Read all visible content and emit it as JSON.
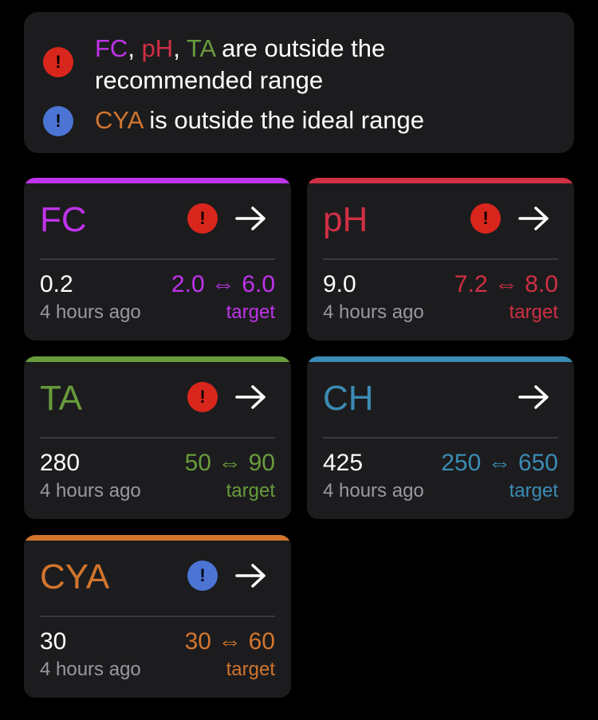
{
  "colors": {
    "fc": "#bf33ea",
    "ph": "#d02f44",
    "ta": "#689b3c",
    "ch": "#3b8cb5",
    "cya": "#d2752e",
    "warn_red": "#d9261c",
    "warn_blue": "#4b74d4",
    "card_bg": "#1c1c1e",
    "muted_text": "#98989e"
  },
  "alerts": {
    "recommended": {
      "icon": "exclamation-icon",
      "fc": "FC",
      "sep1": ", ",
      "ph": "pH",
      "sep2": ", ",
      "ta": "TA",
      "text_line1": " are outside the",
      "text_line2": "recommended range"
    },
    "ideal": {
      "icon": "exclamation-icon",
      "cya": "CYA",
      "text": " is outside the ideal range"
    }
  },
  "cards": {
    "fc": {
      "title": "FC",
      "value": "0.2",
      "time": "4 hours ago",
      "range": "2.0 ⇔ 6.0",
      "target": "target",
      "warning": "red"
    },
    "ph": {
      "title": "pH",
      "value": "9.0",
      "time": "4 hours ago",
      "range": "7.2 ⇔ 8.0",
      "target": "target",
      "warning": "red"
    },
    "ta": {
      "title": "TA",
      "value": "280",
      "time": "4 hours ago",
      "range": "50 ⇔ 90",
      "target": "target",
      "warning": "red"
    },
    "ch": {
      "title": "CH",
      "value": "425",
      "time": "4 hours ago",
      "range": "250 ⇔ 650",
      "target": "target",
      "warning": "none"
    },
    "cya": {
      "title": "CYA",
      "value": "30",
      "time": "4 hours ago",
      "range": "30 ⇔ 60",
      "target": "target",
      "warning": "blue"
    }
  },
  "icons": {
    "warning": "!",
    "arrow": "arrow-right-icon"
  }
}
